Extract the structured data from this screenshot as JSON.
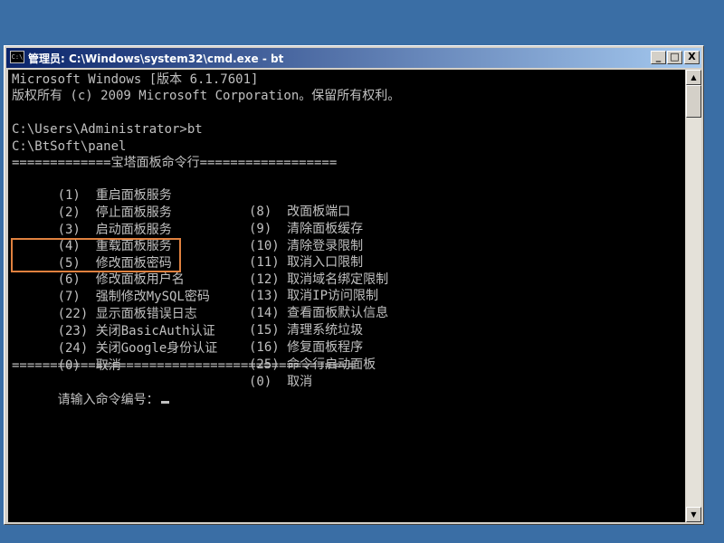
{
  "window": {
    "title": "管理员: C:\\Windows\\system32\\cmd.exe - bt",
    "icon": "C:\\",
    "minimize": "_",
    "maximize": "□",
    "close": "X"
  },
  "console": {
    "banner1": "Microsoft Windows [版本 6.1.7601]",
    "banner2": "版权所有 (c) 2009 Microsoft Corporation。保留所有权利。",
    "prompt_cmd": "C:\\Users\\Administrator>bt",
    "path": "C:\\BtSoft\\panel",
    "header": "=============宝塔面板命令行==================",
    "menu": [
      {
        "left": "(1)  重启面板服务",
        "right": "(8)  改面板端口"
      },
      {
        "left": "(2)  停止面板服务",
        "right": "(9)  清除面板缓存"
      },
      {
        "left": "(3)  启动面板服务",
        "right": "(10) 清除登录限制"
      },
      {
        "left": "(4)  重载面板服务",
        "right": "(11) 取消入口限制"
      },
      {
        "left": "(5)  修改面板密码",
        "right": "(12) 取消域名绑定限制"
      },
      {
        "left": "(6)  修改面板用户名",
        "right": "(13) 取消IP访问限制"
      },
      {
        "left": "(7)  强制修改MySQL密码",
        "right": "(14) 查看面板默认信息"
      },
      {
        "left": "(22) 显示面板错误日志",
        "right": "(15) 清理系统垃圾"
      },
      {
        "left": "(23) 关闭BasicAuth认证",
        "right": "(16) 修复面板程序"
      },
      {
        "left": "(24) 关闭Google身份认证",
        "right": "(25) 命令行启动面板"
      },
      {
        "left": "(0)  取消",
        "right": "(0)  取消"
      }
    ],
    "footer": "=============================================",
    "input_prompt": "请输入命令编号："
  },
  "colors": {
    "desktop": "#3a6ea5",
    "console_bg": "#000000",
    "console_text": "#c0c0c0",
    "highlight": "#e0813f",
    "titlebar_start": "#0a246a",
    "titlebar_end": "#a6caf0"
  }
}
